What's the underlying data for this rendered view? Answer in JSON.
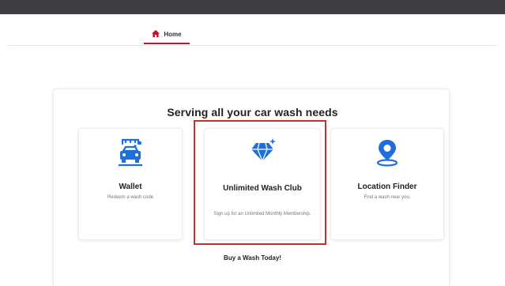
{
  "nav": {
    "home_label": "Home",
    "home_icon": "home-icon",
    "accent_color": "#c8102e"
  },
  "main": {
    "headline": "Serving all your car wash needs",
    "cards": [
      {
        "title": "Wallet",
        "description": "Redeem a wash code",
        "icon": "car-wash-icon"
      },
      {
        "title": "Unlimited Wash Club",
        "description": "Sign up for an Unlimited Monthly Membership.",
        "icon": "diamond-icon"
      },
      {
        "title": "Location Finder",
        "description": "Find a wash near you.",
        "icon": "location-pin-icon"
      }
    ],
    "cta_label": "Buy a Wash Today!"
  },
  "colors": {
    "topbar": "#3d3d42",
    "icon_blue": "#1e6fd9",
    "highlight_border": "#c0312b"
  }
}
